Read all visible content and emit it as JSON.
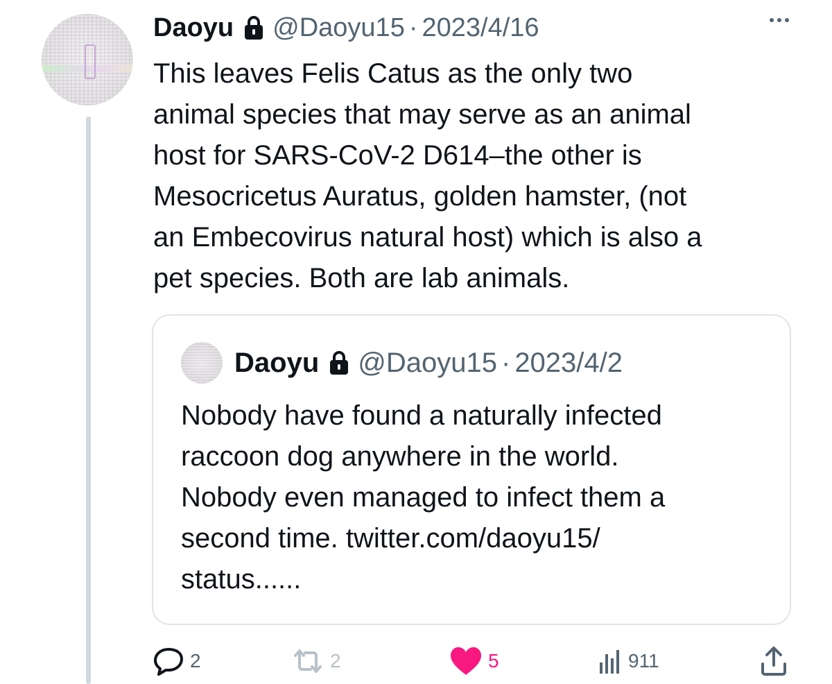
{
  "tweet": {
    "author_name": "Daoyu",
    "handle": "@Daoyu15",
    "separator": "·",
    "date": "2023/4/16",
    "text": "This leaves Felis Catus as the only two\nanimal species that may serve as an animal\nhost for SARS-CoV-2 D614–the other is\nMesocricetus Auratus, golden hamster, (not\nan Embecovirus natural host) which is also a\npet species. Both are lab animals.",
    "more_icon": "more-dots-icon",
    "lock_icon": "lock-icon"
  },
  "quote": {
    "author_name": "Daoyu",
    "handle": "@Daoyu15",
    "separator": "·",
    "date": "2023/4/2",
    "text": "Nobody have found a naturally infected\nraccoon dog anywhere in the world.\nNobody even managed to infect them a\nsecond time. twitter.com/daoyu15/\nstatus......"
  },
  "actions": {
    "reply_count": "2",
    "retweet_count": "2",
    "like_count": "5",
    "views_count": "911",
    "icons": [
      "reply-icon",
      "retweet-icon",
      "like-icon",
      "views-icon",
      "share-icon"
    ]
  },
  "colors": {
    "text": "#0f1419",
    "secondary": "#536471",
    "like": "#f91880",
    "border": "#dfe4e8",
    "thread_line": "#cfd9de"
  }
}
